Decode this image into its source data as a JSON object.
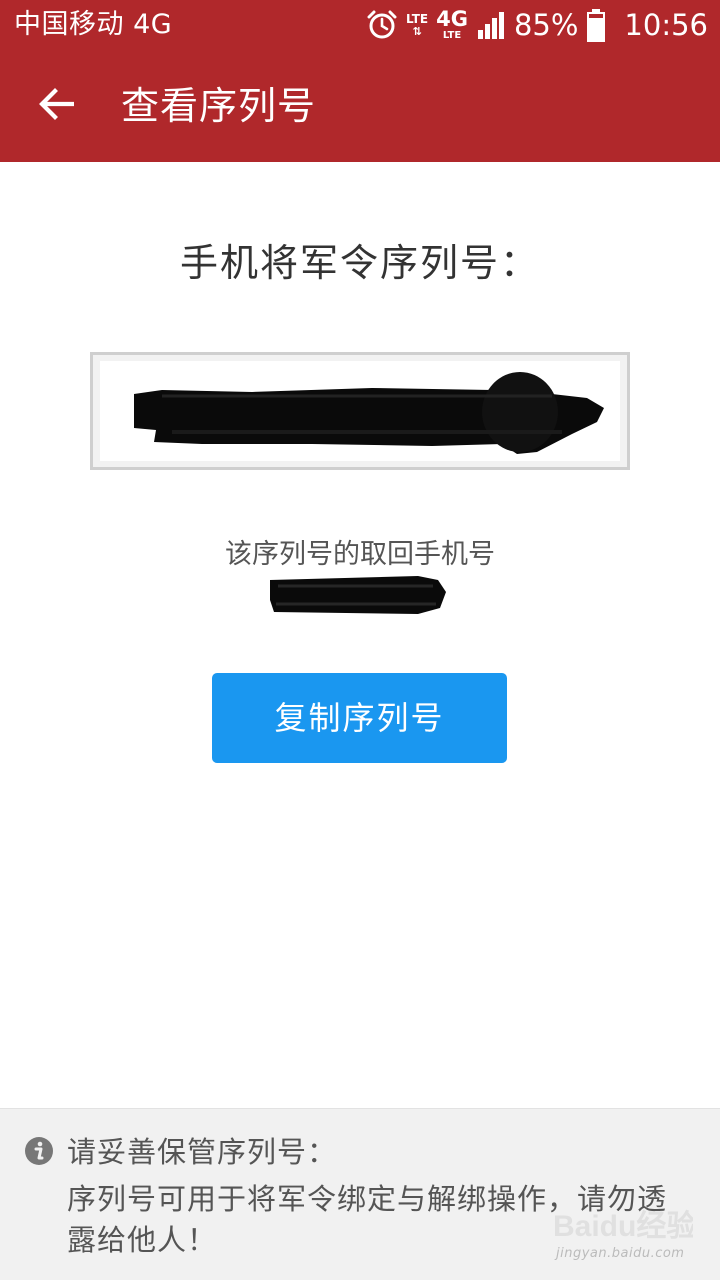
{
  "status_bar": {
    "carrier": "中国移动 4G",
    "net_top": "LTE",
    "net_big": "4G",
    "net_sub": "LTE",
    "battery": "85%",
    "time": "10:56"
  },
  "toolbar": {
    "title": "查看序列号"
  },
  "main": {
    "serial_heading": "手机将军令序列号：",
    "phone_label": "该序列号的取回手机号",
    "copy_button": "复制序列号"
  },
  "notice": {
    "title": "请妥善保管序列号：",
    "body": "序列号可用于将军令绑定与解绑操作，请勿透露给他人！"
  },
  "watermark": {
    "brand": "Baidu经验",
    "url": "jingyan.baidu.com"
  },
  "colors": {
    "header": "#b0282b",
    "button": "#1a97f0",
    "notice_bg": "#f1f1f1"
  },
  "icons": [
    "back-arrow-icon",
    "alarm-icon",
    "signal-icon",
    "battery-icon",
    "info-icon"
  ]
}
